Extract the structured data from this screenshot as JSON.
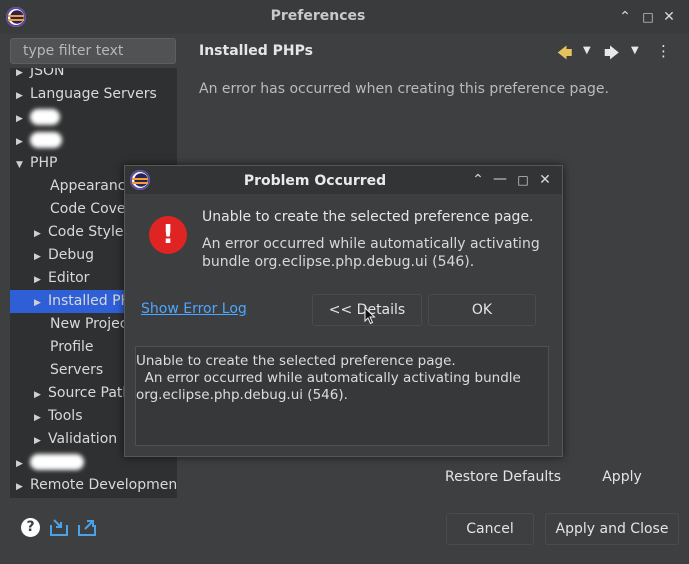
{
  "window": {
    "title": "Preferences",
    "controls": [
      "chevron-up",
      "maximize",
      "close"
    ]
  },
  "filter": {
    "placeholder": "type filter text"
  },
  "tree": {
    "items": {
      "json": "JSON",
      "language_servers": "Language Servers",
      "php": "PHP",
      "appearance": "Appearance",
      "code_coverage": "Code Cover",
      "code_style": "Code Style",
      "debug": "Debug",
      "editor": "Editor",
      "installed_phps": "Installed PH",
      "new_project": "New Projec",
      "profile": "Profile",
      "servers": "Servers",
      "source_path": "Source Path",
      "tools": "Tools",
      "validation": "Validation",
      "remote_development": "Remote Development"
    },
    "selected": "installed_phps"
  },
  "page": {
    "title": "Installed PHPs",
    "message": "An error has occurred when creating this preference page."
  },
  "buttons": {
    "restore_defaults": "Restore Defaults",
    "apply": "Apply",
    "cancel": "Cancel",
    "apply_and_close": "Apply and Close"
  },
  "dialog": {
    "title": "Problem Occurred",
    "heading": "Unable to create the selected preference page.",
    "message_line1": "An error occurred while automatically activating",
    "message_line2": "bundle org.eclipse.php.debug.ui (546).",
    "show_error_log": "Show Error Log",
    "details_button": "<< Details",
    "ok_button": "OK",
    "details_lines": [
      "Unable to create the selected preference page.",
      "  An error occurred while automatically activating bundle",
      "org.eclipse.php.debug.ui (546)."
    ]
  },
  "colors": {
    "selection": "#2e5fd6",
    "error": "#e02424",
    "link": "#4da6ff",
    "nav_arrows": "#e6c35a"
  }
}
